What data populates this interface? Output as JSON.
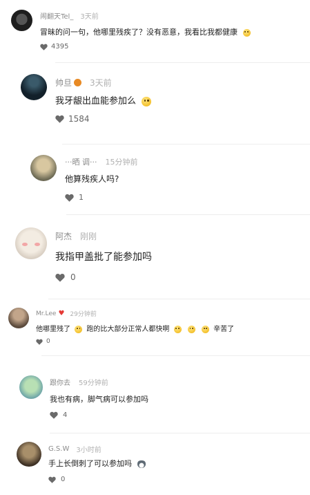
{
  "comments": [
    {
      "name": "闹翻天Tel_",
      "time": "3天前",
      "text": "冒昧的问一句，他哪里残疾了？没有恶意，我看比我都健康",
      "likes": "4395"
    },
    {
      "name": "帅旦",
      "time": "3天前",
      "text": "我牙龈出血能参加么",
      "likes": "1584"
    },
    {
      "name": "···晒 调···",
      "time": "15分钟前",
      "text": "他算残疾人吗?",
      "likes": "1"
    },
    {
      "name": "阿杰",
      "time": "刚刚",
      "text": "我指甲盖批了能参加吗",
      "likes": "0"
    },
    {
      "name": "Mr.Lee",
      "time": "29分钟前",
      "text_a": "他哪里残了",
      "text_b": "跑的比大部分正常人都快啊",
      "text_c": "辛苦了",
      "likes": "0"
    },
    {
      "name": "跟你去",
      "time": "59分钟前",
      "text": "我也有病，脚气病可以参加吗",
      "likes": "4"
    },
    {
      "name": "G.S.W",
      "time": "3小时前",
      "text": "手上长倒刺了可以参加吗",
      "likes": "0"
    }
  ],
  "icons": {
    "like": "heart-icon",
    "emoji": "smiley-emoji-icon"
  }
}
